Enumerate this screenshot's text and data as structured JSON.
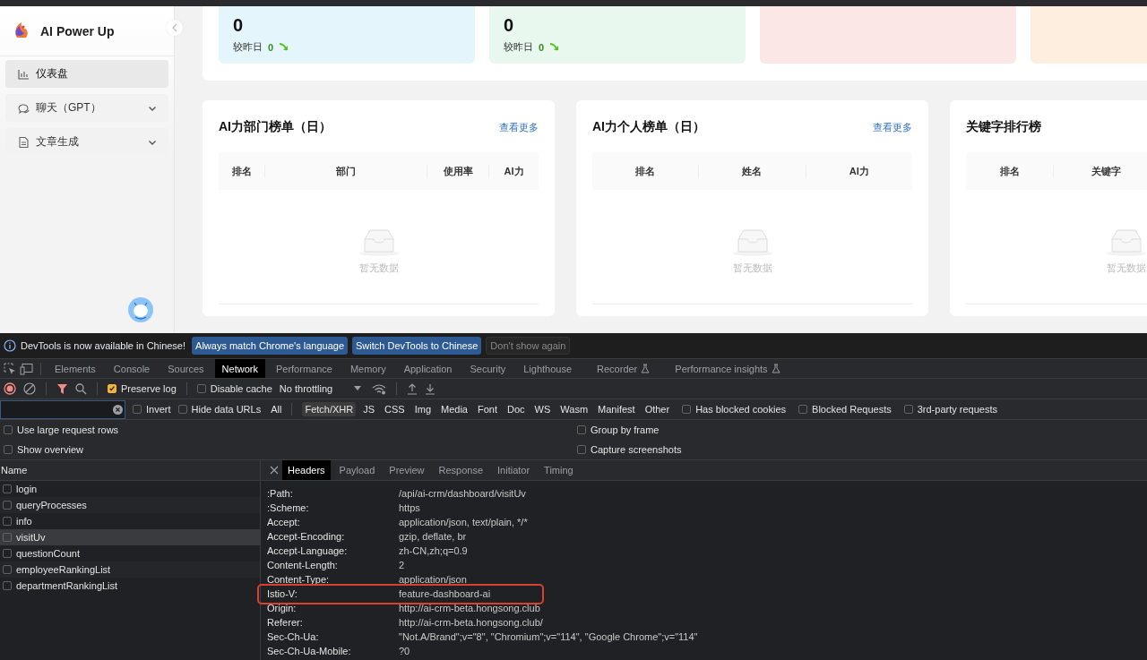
{
  "sidebar": {
    "brand": "AI Power Up",
    "items": [
      {
        "label": "仪表盘",
        "kind": "link",
        "selected": true
      },
      {
        "label": "聊天（GPT）",
        "kind": "submenu",
        "selected": false
      },
      {
        "label": "文章生成",
        "kind": "submenu",
        "selected": false
      }
    ]
  },
  "stats": [
    {
      "color": "#e4f6fb",
      "value": "0",
      "compare_label": "较昨日",
      "change": "0"
    },
    {
      "color": "#e8f8ee",
      "value": "0",
      "compare_label": "较昨日",
      "change": "0"
    },
    {
      "color": "#fbe7e5"
    },
    {
      "color": "#fdeedf"
    }
  ],
  "rankings": [
    {
      "title": "AI力部门榜单（日）",
      "more": "查看更多",
      "columns": [
        "排名",
        "部门",
        "使用率",
        "AI力"
      ],
      "empty": "暂无数据"
    },
    {
      "title": "AI力个人榜单（日）",
      "more": "查看更多",
      "columns": [
        "排名",
        "姓名",
        "AI力"
      ],
      "empty": "暂无数据"
    },
    {
      "title": "关键字排行榜",
      "columns": [
        "排名",
        "关键字"
      ],
      "empty": "暂无数据"
    }
  ],
  "devtools": {
    "banner": {
      "message": "DevTools is now available in Chinese!",
      "buttons": [
        {
          "label": "Always match Chrome's language",
          "kind": "primary"
        },
        {
          "label": "Switch DevTools to Chinese",
          "kind": "primary"
        },
        {
          "label": "Don't show again",
          "kind": "plain"
        }
      ]
    },
    "tabs": [
      {
        "label": "Elements",
        "selected": false,
        "experimental": false
      },
      {
        "label": "Console",
        "selected": false,
        "experimental": false
      },
      {
        "label": "Sources",
        "selected": false,
        "experimental": false
      },
      {
        "label": "Network",
        "selected": true,
        "experimental": false
      },
      {
        "label": "Performance",
        "selected": false,
        "experimental": false
      },
      {
        "label": "Memory",
        "selected": false,
        "experimental": false
      },
      {
        "label": "Application",
        "selected": false,
        "experimental": false
      },
      {
        "label": "Security",
        "selected": false,
        "experimental": false
      },
      {
        "label": "Lighthouse",
        "selected": false,
        "experimental": false
      },
      {
        "label": "Recorder",
        "selected": false,
        "experimental": true
      },
      {
        "label": "Performance insights",
        "selected": false,
        "experimental": true
      }
    ],
    "toolbar": {
      "preserve_log": {
        "label": "Preserve log",
        "checked": true
      },
      "disable_cache": {
        "label": "Disable cache",
        "checked": false
      },
      "throttling": "No throttling"
    },
    "filter": {
      "invert": {
        "label": "Invert",
        "checked": false
      },
      "hide_data_urls": {
        "label": "Hide data URLs",
        "checked": false
      },
      "types": [
        {
          "label": "All",
          "selected": false
        },
        {
          "label": "Fetch/XHR",
          "selected": true
        },
        {
          "label": "JS",
          "selected": false
        },
        {
          "label": "CSS",
          "selected": false
        },
        {
          "label": "Img",
          "selected": false
        },
        {
          "label": "Media",
          "selected": false
        },
        {
          "label": "Font",
          "selected": false
        },
        {
          "label": "Doc",
          "selected": false
        },
        {
          "label": "WS",
          "selected": false
        },
        {
          "label": "Wasm",
          "selected": false
        },
        {
          "label": "Manifest",
          "selected": false
        },
        {
          "label": "Other",
          "selected": false
        }
      ],
      "flags": [
        {
          "label": "Has blocked cookies",
          "checked": false
        },
        {
          "label": "Blocked Requests",
          "checked": false
        },
        {
          "label": "3rd-party requests",
          "checked": false
        }
      ]
    },
    "options_left": [
      {
        "label": "Use large request rows",
        "checked": false
      },
      {
        "label": "Show overview",
        "checked": false
      }
    ],
    "options_right": [
      {
        "label": "Group by frame",
        "checked": false
      },
      {
        "label": "Capture screenshots",
        "checked": false
      }
    ],
    "requests": {
      "header": "Name",
      "rows": [
        {
          "name": "login",
          "selected": false
        },
        {
          "name": "queryProcesses",
          "selected": false
        },
        {
          "name": "info",
          "selected": false
        },
        {
          "name": "visitUv",
          "selected": true
        },
        {
          "name": "questionCount",
          "selected": false
        },
        {
          "name": "employeeRankingList",
          "selected": false
        },
        {
          "name": "departmentRankingList",
          "selected": false
        }
      ]
    },
    "details": {
      "tabs": [
        {
          "label": "Headers",
          "selected": true
        },
        {
          "label": "Payload",
          "selected": false
        },
        {
          "label": "Preview",
          "selected": false
        },
        {
          "label": "Response",
          "selected": false
        },
        {
          "label": "Initiator",
          "selected": false
        },
        {
          "label": "Timing",
          "selected": false
        }
      ],
      "headers": [
        {
          "name": ":Path:",
          "value": "/api/ai-crm/dashboard/visitUv",
          "highlighted": false
        },
        {
          "name": ":Scheme:",
          "value": "https",
          "highlighted": false
        },
        {
          "name": "Accept:",
          "value": "application/json, text/plain, */*",
          "highlighted": false
        },
        {
          "name": "Accept-Encoding:",
          "value": "gzip, deflate, br",
          "highlighted": false
        },
        {
          "name": "Accept-Language:",
          "value": "zh-CN,zh;q=0.9",
          "highlighted": false
        },
        {
          "name": "Content-Length:",
          "value": "2",
          "highlighted": false
        },
        {
          "name": "Content-Type:",
          "value": "application/json",
          "highlighted": false
        },
        {
          "name": "Istio-V:",
          "value": "feature-dashboard-ai",
          "highlighted": true
        },
        {
          "name": "Origin:",
          "value": "http://ai-crm-beta.hongsong.club",
          "highlighted": false
        },
        {
          "name": "Referer:",
          "value": "http://ai-crm-beta.hongsong.club/",
          "highlighted": false
        },
        {
          "name": "Sec-Ch-Ua:",
          "value": "\"Not.A/Brand\";v=\"8\", \"Chromium\";v=\"114\", \"Google Chrome\";v=\"114\"",
          "highlighted": false
        },
        {
          "name": "Sec-Ch-Ua-Mobile:",
          "value": "?0",
          "highlighted": false
        }
      ]
    }
  }
}
